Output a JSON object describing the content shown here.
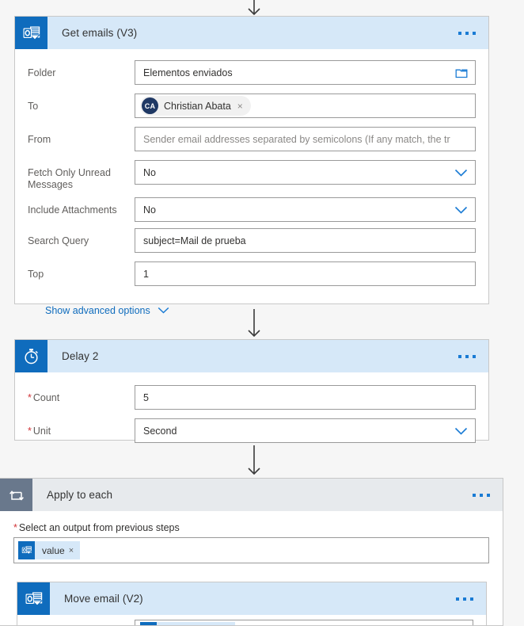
{
  "theme": {
    "accent": "#0f6cbd",
    "header_blue": "#d6e8f8",
    "header_gray": "#e7eaed",
    "scope_icon_bg": "#69788c",
    "required_red": "#d13438",
    "canvas_bg": "#f6f6f6",
    "label_gray": "#605e5c"
  },
  "flow": {
    "get_emails": {
      "title": "Get emails (V3)",
      "icon": "outlook-icon",
      "menu": "more-commands-ellipsis",
      "fields": [
        {
          "label": "Folder",
          "type": "text-with-picker",
          "value": "Elementos enviados",
          "trailing_icon": "folder-picker-icon"
        },
        {
          "label": "To",
          "type": "people-picker",
          "chip": {
            "initials": "CA",
            "name": "Christian Abata",
            "remove": "×"
          }
        },
        {
          "label": "From",
          "type": "text",
          "value": "",
          "placeholder": "Sender email addresses separated by semicolons (If any match, the tr"
        },
        {
          "label": "Fetch Only Unread Messages",
          "type": "dropdown",
          "value": "No",
          "trailing_icon": "chevron-down-icon"
        },
        {
          "label": "Include Attachments",
          "type": "dropdown",
          "value": "No",
          "trailing_icon": "chevron-down-icon"
        },
        {
          "label": "Search Query",
          "type": "text",
          "value": "subject=Mail de prueba"
        },
        {
          "label": "Top",
          "type": "text",
          "value": "1"
        }
      ],
      "advanced_link": "Show advanced options",
      "advanced_icon": "chevron-down-icon"
    },
    "delay": {
      "title": "Delay 2",
      "icon": "stopwatch-icon",
      "menu": "more-commands-ellipsis",
      "fields": [
        {
          "label": "Count",
          "required": true,
          "type": "text",
          "value": "5"
        },
        {
          "label": "Unit",
          "required": true,
          "type": "dropdown",
          "value": "Second",
          "trailing_icon": "chevron-down-icon"
        }
      ]
    },
    "apply_to_each": {
      "title": "Apply to each",
      "icon": "loop-icon",
      "menu": "more-commands-ellipsis",
      "output_label": "Select an output from previous steps",
      "output_required": true,
      "output_token": {
        "icon": "outlook-icon",
        "label": "value",
        "remove": "×"
      },
      "nested": {
        "title": "Move email (V2)",
        "icon": "outlook-icon",
        "menu": "more-commands-ellipsis"
      }
    }
  }
}
